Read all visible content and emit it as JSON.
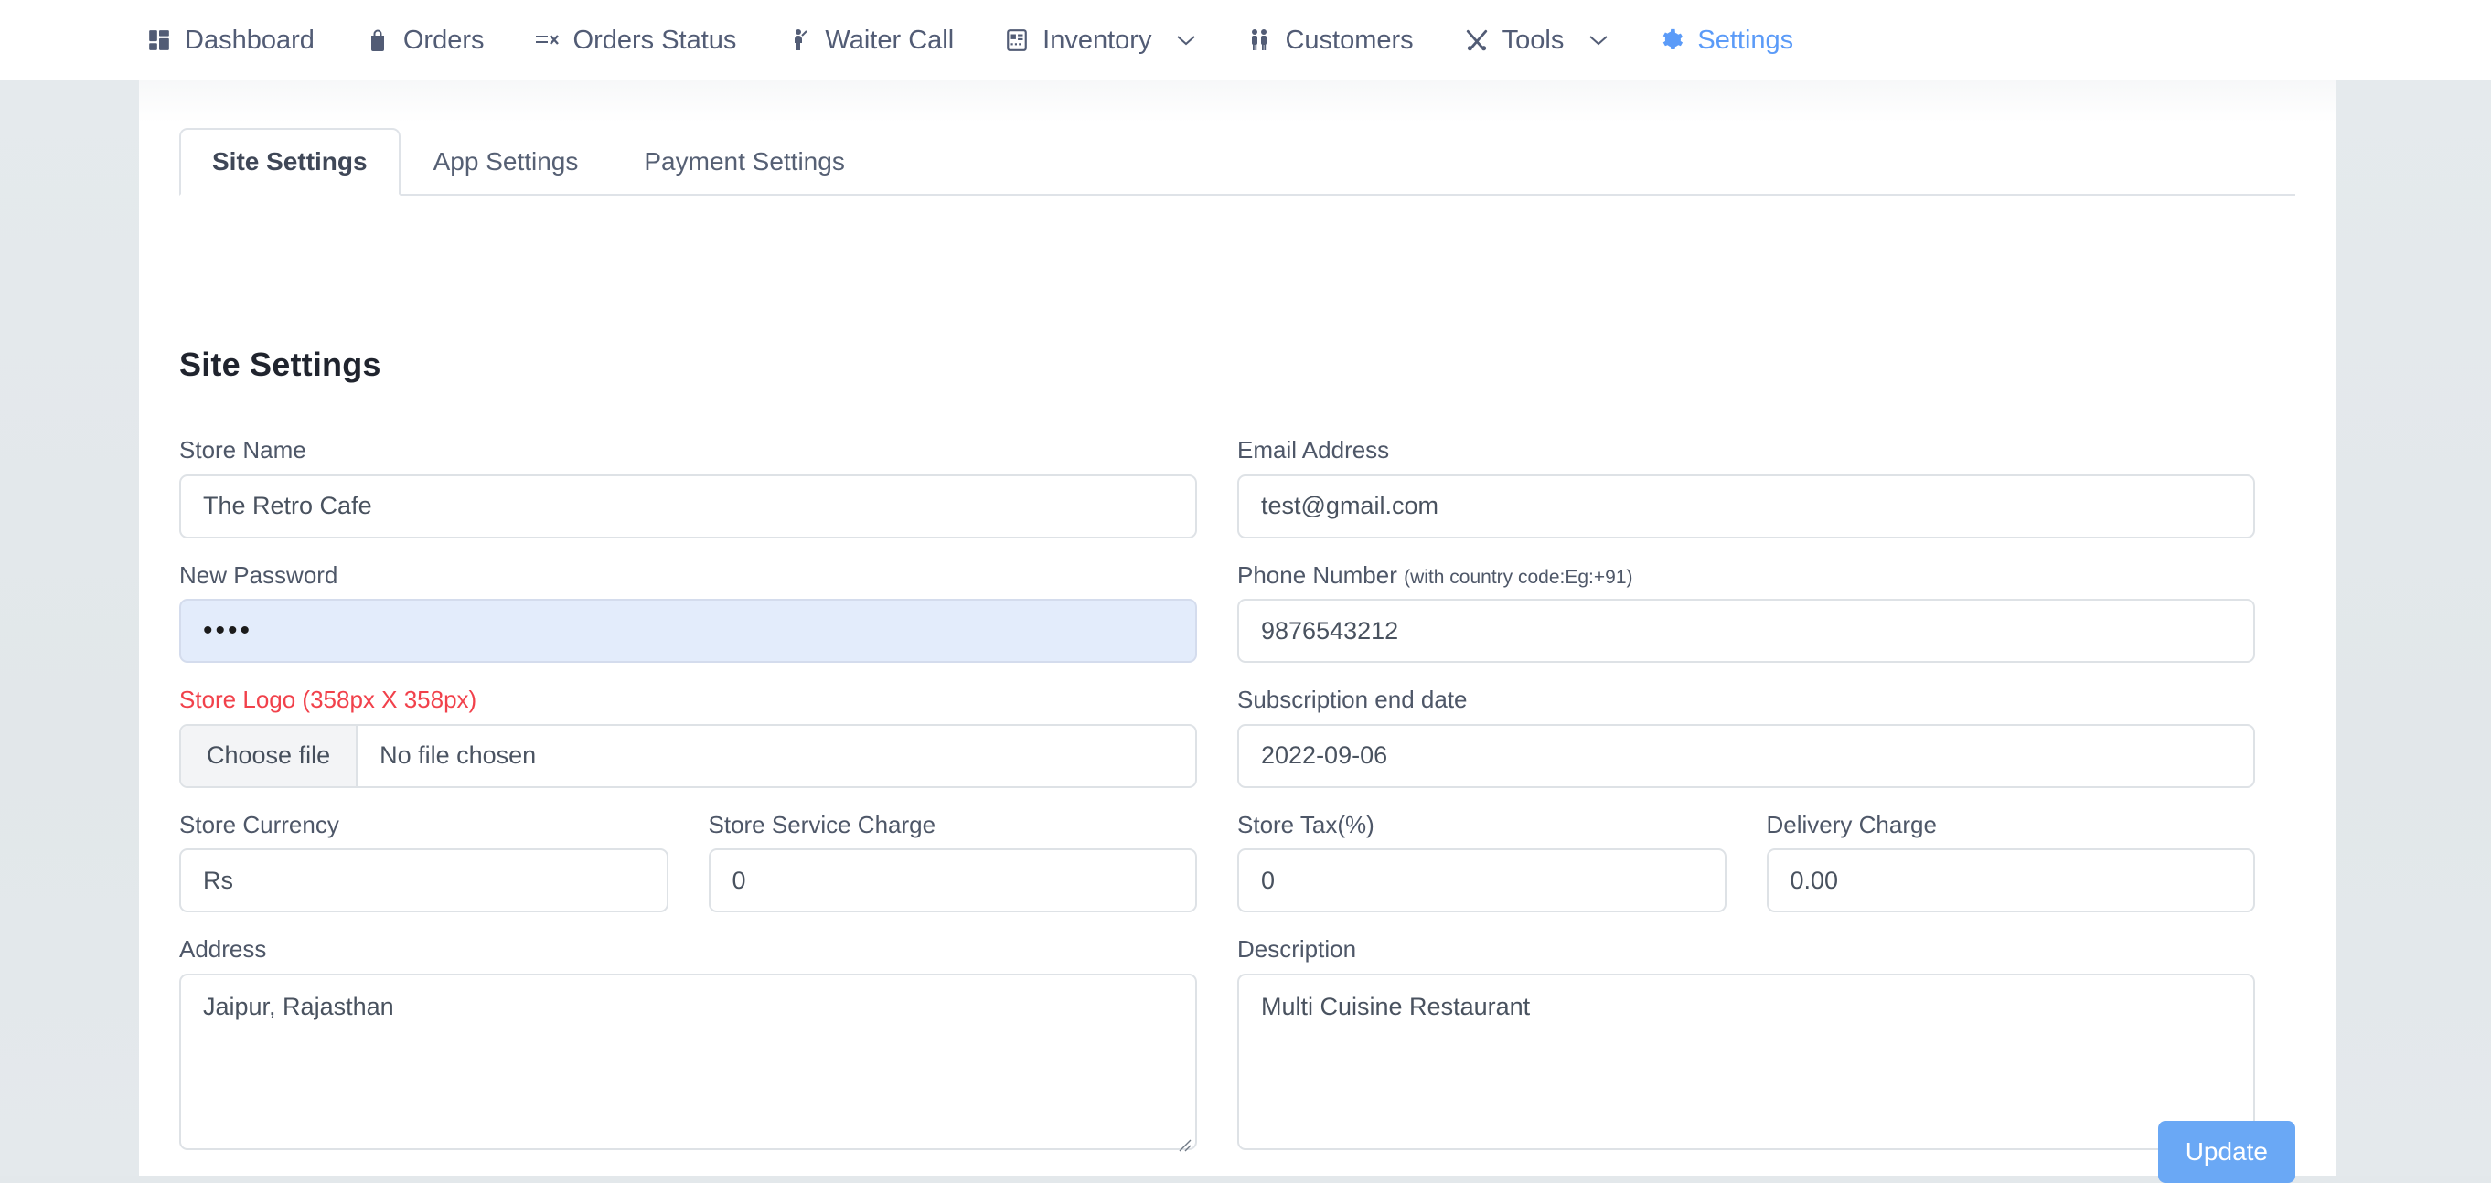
{
  "nav": {
    "items": [
      {
        "label": "Dashboard",
        "icon": "dashboard-grid-icon",
        "active": false,
        "caret": false
      },
      {
        "label": "Orders",
        "icon": "bag-icon",
        "active": false,
        "caret": false
      },
      {
        "label": "Orders Status",
        "icon": "list-check-icon",
        "active": false,
        "caret": false
      },
      {
        "label": "Waiter Call",
        "icon": "waiter-icon",
        "active": false,
        "caret": false
      },
      {
        "label": "Inventory",
        "icon": "inventory-box-icon",
        "active": false,
        "caret": true
      },
      {
        "label": "Customers",
        "icon": "customers-icon",
        "active": false,
        "caret": false
      },
      {
        "label": "Tools",
        "icon": "tools-cross-icon",
        "active": false,
        "caret": true
      },
      {
        "label": "Settings",
        "icon": "gear-icon",
        "active": true,
        "caret": false
      }
    ],
    "active_color": "#5b9bf8",
    "text_color": "#525c75"
  },
  "tabs": [
    {
      "label": "Site Settings",
      "active": true
    },
    {
      "label": "App Settings",
      "active": false
    },
    {
      "label": "Payment Settings",
      "active": false
    }
  ],
  "page": {
    "heading": "Site Settings"
  },
  "form": {
    "store_name": {
      "label": "Store Name",
      "value": "The Retro Cafe"
    },
    "email": {
      "label": "Email Address",
      "value": "test@gmail.com"
    },
    "new_password": {
      "label": "New Password",
      "value": "••••",
      "autofilled": true
    },
    "phone": {
      "label": "Phone Number",
      "sub_label": "(with country code:Eg:+91)",
      "value": "9876543212"
    },
    "store_logo": {
      "label": "Store Logo (358px X 358px)",
      "button": "Choose file",
      "file_status": "No file chosen",
      "label_color": "#f1414b"
    },
    "subscription_end": {
      "label": "Subscription end date",
      "value": "2022-09-06"
    },
    "store_currency": {
      "label": "Store Currency",
      "value": "Rs"
    },
    "service_charge": {
      "label": "Store Service Charge",
      "value": "0"
    },
    "store_tax": {
      "label": "Store Tax(%)",
      "value": "0"
    },
    "delivery_charge": {
      "label": "Delivery Charge",
      "value": "0.00"
    },
    "address": {
      "label": "Address",
      "value": "Jaipur, Rajasthan"
    },
    "description": {
      "label": "Description",
      "value": "Multi Cuisine Restaurant"
    }
  },
  "footer": {
    "update_label": "Update",
    "update_color": "#6aa8f5"
  }
}
